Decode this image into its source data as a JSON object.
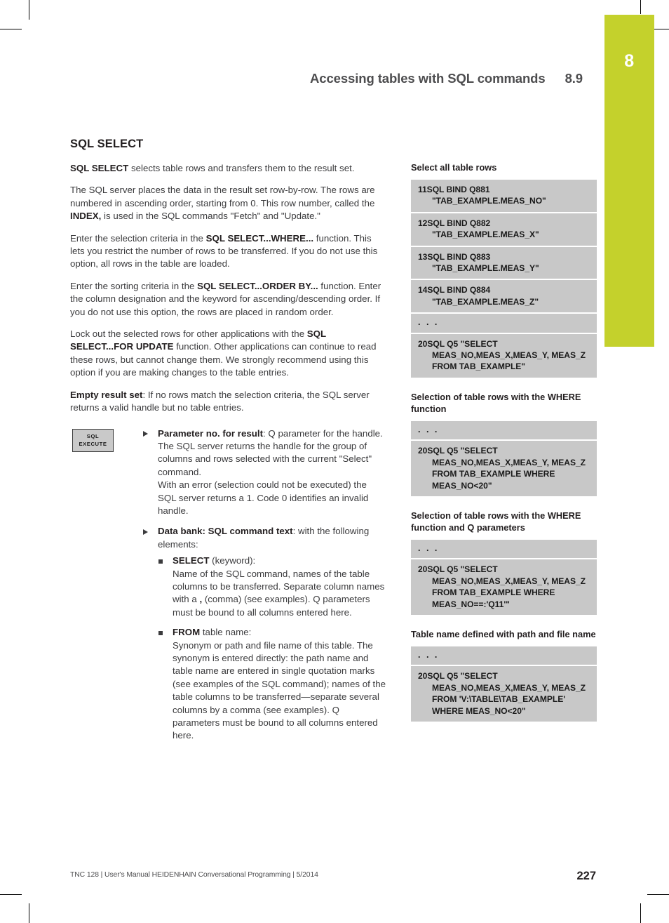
{
  "chapter_tab": {
    "number": "8",
    "color": "#c4d12c"
  },
  "header": {
    "title": "Accessing tables with SQL commands",
    "section_number": "8.9"
  },
  "left_column": {
    "section_title": "SQL SELECT",
    "paragraphs": [
      {
        "runs": [
          {
            "text": "SQL SELECT",
            "bold": true
          },
          {
            "text": " selects table rows and transfers them to the result set.",
            "bold": false
          }
        ]
      },
      {
        "runs": [
          {
            "text": "The SQL server places the data in the result set row-by-row. The rows are numbered in ascending order, starting from 0. This row number, called the ",
            "bold": false
          },
          {
            "text": "INDEX,",
            "bold": true
          },
          {
            "text": " is used in the SQL commands \"Fetch\" and \"Update.\"",
            "bold": false
          }
        ]
      },
      {
        "runs": [
          {
            "text": "Enter the selection criteria in the ",
            "bold": false
          },
          {
            "text": "SQL SELECT...WHERE...",
            "bold": true
          },
          {
            "text": " function. This lets you restrict the number of rows to be transferred. If you do not use this option, all rows in the table are loaded.",
            "bold": false
          }
        ]
      },
      {
        "runs": [
          {
            "text": "Enter the sorting criteria in the ",
            "bold": false
          },
          {
            "text": "SQL SELECT...ORDER BY...",
            "bold": true
          },
          {
            "text": " function. Enter the column designation and the keyword for ascending/descending order. If you do not use this option, the rows are placed in random order.",
            "bold": false
          }
        ]
      },
      {
        "runs": [
          {
            "text": "Lock out the selected rows for other applications with the ",
            "bold": false
          },
          {
            "text": "SQL SELECT...FOR UPDATE",
            "bold": true
          },
          {
            "text": " function. Other applications can continue to read these rows, but cannot change them. We strongly recommend using this option if you are making changes to the table entries.",
            "bold": false
          }
        ]
      },
      {
        "runs": [
          {
            "text": "Empty result set",
            "bold": true
          },
          {
            "text": ": If no rows match the selection criteria, the SQL server returns a valid handle but no table entries.",
            "bold": false
          }
        ]
      }
    ],
    "softkey": {
      "line1": "SQL",
      "line2": "EXECUTE"
    },
    "bullets": [
      {
        "runs": [
          {
            "text": "Parameter no. for result",
            "bold": true
          },
          {
            "text": ": Q parameter for the handle. The SQL server returns the handle for the group of columns and rows selected with the current \"Select\" command.",
            "bold": false
          },
          {
            "text": "\nWith an error (selection could not be executed) the SQL server returns a 1. Code 0 identifies an invalid handle.",
            "bold": false
          }
        ]
      },
      {
        "runs": [
          {
            "text": "Data bank: SQL command text",
            "bold": true
          },
          {
            "text": ": with the following elements:",
            "bold": false
          }
        ],
        "sub_bullets": [
          {
            "runs": [
              {
                "text": "SELECT",
                "bold": true
              },
              {
                "text": " (keyword):",
                "bold": false
              },
              {
                "text": "\nName of the SQL command, names of the table columns to be transferred. Separate column names with a ",
                "bold": false
              },
              {
                "text": ",",
                "bold": true
              },
              {
                "text": " (comma) (see examples). Q parameters must be bound to all columns entered here.",
                "bold": false
              }
            ]
          },
          {
            "runs": [
              {
                "text": "FROM",
                "bold": true
              },
              {
                "text": " table name:",
                "bold": false
              },
              {
                "text": "\nSynonym or path and file name of this table. The synonym is entered directly: the path name and table name are entered in single quotation marks (see examples of the SQL command); names of the table columns to be transferred—separate several columns by a comma (see examples). Q parameters must be bound to all columns entered here.",
                "bold": false
              }
            ]
          }
        ]
      }
    ]
  },
  "right_column": {
    "samples": [
      {
        "title": "Select all table rows",
        "rows": [
          {
            "main": "11SQL BIND Q881",
            "cont": "\"TAB_EXAMPLE.MEAS_NO\"",
            "ellipsis": false
          },
          {
            "main": "12SQL BIND Q882",
            "cont": "\"TAB_EXAMPLE.MEAS_X\"",
            "ellipsis": false
          },
          {
            "main": "13SQL BIND Q883",
            "cont": "\"TAB_EXAMPLE.MEAS_Y\"",
            "ellipsis": false
          },
          {
            "main": "14SQL BIND Q884",
            "cont": "\"TAB_EXAMPLE.MEAS_Z\"",
            "ellipsis": false
          },
          {
            "main": ". . .",
            "cont": "",
            "ellipsis": true
          },
          {
            "main": "20SQL Q5 \"SELECT",
            "cont": "MEAS_NO,MEAS_X,MEAS_Y, MEAS_Z\nFROM TAB_EXAMPLE\"",
            "ellipsis": false
          }
        ]
      },
      {
        "title": "Selection of table rows with the WHERE function",
        "rows": [
          {
            "main": ". . .",
            "cont": "",
            "ellipsis": true
          },
          {
            "main": "20SQL Q5 \"SELECT",
            "cont": "MEAS_NO,MEAS_X,MEAS_Y, MEAS_Z\nFROM TAB_EXAMPLE WHERE\nMEAS_NO<20\"",
            "ellipsis": false
          }
        ]
      },
      {
        "title": "Selection of table rows with the WHERE function and Q parameters",
        "rows": [
          {
            "main": ". . .",
            "cont": "",
            "ellipsis": true
          },
          {
            "main": "20SQL Q5 \"SELECT",
            "cont": "MEAS_NO,MEAS_X,MEAS_Y, MEAS_Z\nFROM TAB_EXAMPLE WHERE\nMEAS_NO==:'Q11'\"",
            "ellipsis": false
          }
        ]
      },
      {
        "title": "Table name defined with path and file name",
        "rows": [
          {
            "main": ". . .",
            "cont": "",
            "ellipsis": true
          },
          {
            "main": "20SQL Q5 \"SELECT",
            "cont": "MEAS_NO,MEAS_X,MEAS_Y, MEAS_Z\nFROM 'V:\\TABLE\\TAB_EXAMPLE'\nWHERE MEAS_NO<20\"",
            "ellipsis": false
          }
        ]
      }
    ]
  },
  "footer": {
    "text": "TNC 128 | User's Manual HEIDENHAIN Conversational Programming | 5/2014",
    "page_number": "227"
  }
}
